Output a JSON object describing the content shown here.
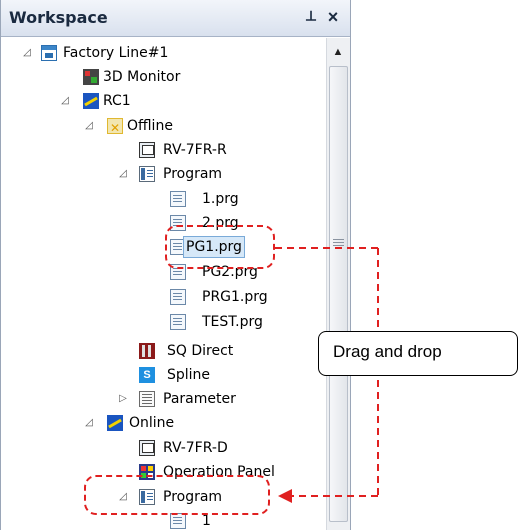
{
  "workspace": {
    "title": "Workspace",
    "pin_glyph": "ᵖ",
    "close_glyph": "×"
  },
  "scrollbar": {
    "up_glyph": "▲"
  },
  "tree": {
    "factory_line": "Factory Line#1",
    "monitor_3d": "3D Monitor",
    "rc1": "RC1",
    "offline": "Offline",
    "offline_robot": "RV-7FR-R",
    "offline_program": "Program",
    "files": [
      "1.prg",
      "2.prg",
      "PG1.prg",
      "PG2.prg",
      "PRG1.prg",
      "TEST.prg"
    ],
    "sq_direct": "SQ Direct",
    "spline": "Spline",
    "parameter": "Parameter",
    "online": "Online",
    "online_robot": "RV-7FR-D",
    "operation_panel": "Operation Panel",
    "online_program": "Program",
    "online_file_1": "1"
  },
  "expanders": {
    "expanded": "◿",
    "collapsed": "▷"
  },
  "icons": {
    "workbench": "workbench-icon",
    "monitor": "3d-monitor-icon",
    "controller": "robot-controller-icon",
    "offline": "offline-icon",
    "robot": "robot-icon",
    "program": "program-folder-icon",
    "file": "program-file-icon",
    "sq": "sq-direct-icon",
    "spline": "spline-icon",
    "parameter": "parameter-icon",
    "online": "online-icon",
    "operation_panel": "operation-panel-icon"
  },
  "spline_glyph": "S",
  "annotation": {
    "callout_text": "Drag and drop",
    "color": "#e02020",
    "arrow_glyph": "◀"
  }
}
